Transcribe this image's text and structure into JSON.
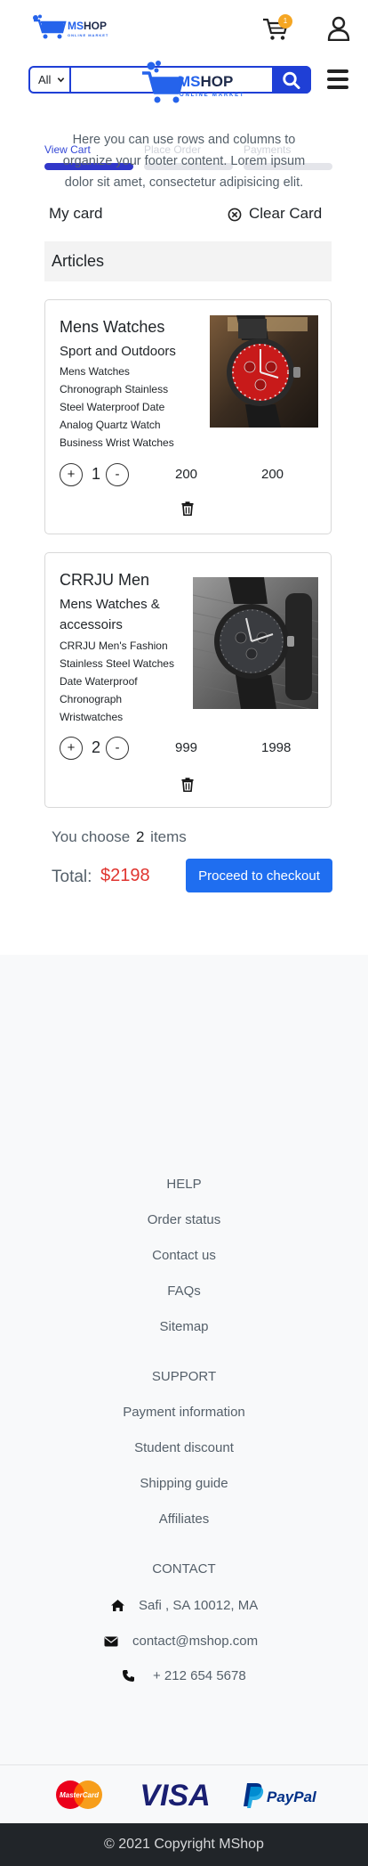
{
  "header": {
    "logo_brand_ms": "MS",
    "logo_brand_rest": "HOP",
    "logo_tagline": "ONLINE MARKET",
    "cart_count": "1"
  },
  "search": {
    "category": "All",
    "placeholder": ""
  },
  "steps": [
    {
      "label": "View Cart",
      "active": true
    },
    {
      "label": "Place Order",
      "active": false
    },
    {
      "label": "Payments",
      "active": false
    }
  ],
  "cart": {
    "title": "My card",
    "clear_label": "Clear Card",
    "section_label": "Articles",
    "items": [
      {
        "title": "Mens Watches",
        "subtitle_lines": [
          "Sport and Outdoors"
        ],
        "desc_lines": [
          "Mens Watches",
          "Chronograph Stainless",
          "Steel Waterproof Date",
          "Analog Quartz Watch",
          "Business Wrist Watches"
        ],
        "quantity": "1",
        "unit_price": "200",
        "line_total": "200"
      },
      {
        "title": "CRRJU Men",
        "subtitle_lines": [
          "Mens Watches &",
          "accessoirs"
        ],
        "desc_lines": [
          "CRRJU Men's Fashion",
          "Stainless Steel Watches",
          "Date Waterproof",
          "Chronograph",
          "Wristwatches"
        ],
        "quantity": "2",
        "unit_price": "999",
        "line_total": "1998"
      }
    ],
    "plus_symbol": "+",
    "minus_symbol": "-"
  },
  "summary": {
    "choose_prefix": "You choose",
    "item_count": "2",
    "choose_suffix": "items",
    "total_label": "Total:",
    "total_value": "$2198",
    "checkout_label": "Proceed to checkout"
  },
  "footer": {
    "logo_brand_ms": "MS",
    "logo_brand_rest": "HOP",
    "logo_tagline": "ONLINE MARKET",
    "description": "Here you can use rows and columns to organize your footer content. Lorem ipsum dolor sit amet, consectetur adipisicing elit.",
    "help_heading": "HELP",
    "help_links": [
      "Order status",
      "Contact us",
      "FAQs",
      "Sitemap"
    ],
    "support_heading": "SUPPORT",
    "support_links": [
      "Payment information",
      "Student discount",
      "Shipping guide",
      "Affiliates"
    ],
    "contact_heading": "CONTACT",
    "address": "Safi , SA 10012, MA",
    "email": "contact@mshop.com",
    "phone": "+ 212 654 5678",
    "payment_methods": [
      "MasterCard",
      "VISA",
      "PayPal"
    ],
    "copyright": "© 2021 Copyright MShop"
  },
  "colors": {
    "primary": "#1f3fd6",
    "checkout": "#1f6ef0",
    "total": "#e0342f",
    "badge": "#f5a623",
    "footer_bg": "#f8f9fa",
    "copyright_bg": "#212529"
  }
}
